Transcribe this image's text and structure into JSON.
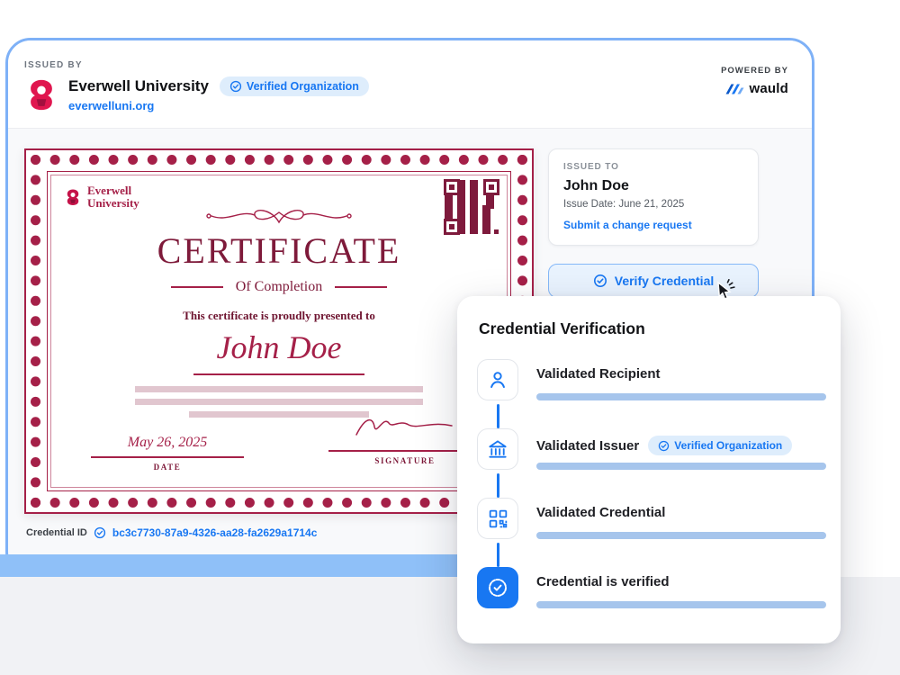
{
  "header": {
    "issued_by_label": "ISSUED BY",
    "org_name": "Everwell University",
    "org_url": "everwelluni.org",
    "verified_badge_label": "Verified Organization",
    "powered_by_label": "POWERED BY",
    "brand_name": "wauld"
  },
  "certificate": {
    "org_line1": "Everwell",
    "org_line2": "University",
    "title": "CERTIFICATE",
    "subtitle": "Of Completion",
    "presented_text": "This certificate is proudly presented to",
    "recipient_name": "John Doe",
    "date_value": "May 26, 2025",
    "date_label": "DATE",
    "signature_label": "SIGNATURE"
  },
  "credential_id": {
    "label": "Credential ID",
    "value": "bc3c7730-87a9-4326-aa28-fa2629a1714c"
  },
  "issued_to": {
    "label": "ISSUED TO",
    "name": "John Doe",
    "issue_date": "Issue Date: June 21, 2025",
    "change_request_label": "Submit a change request"
  },
  "verify_button": {
    "label": "Verify Credential"
  },
  "modal": {
    "title": "Credential Verification",
    "steps": [
      {
        "label": "Validated Recipient",
        "icon": "user-icon",
        "progress_percent": 100
      },
      {
        "label": "Validated Issuer",
        "icon": "bank-icon",
        "badge": "Verified Organization",
        "progress_percent": 100
      },
      {
        "label": "Validated Credential",
        "icon": "qr-icon",
        "progress_percent": 100
      },
      {
        "label": "Credential is verified",
        "icon": "seal-check-icon",
        "progress_percent": 100
      }
    ]
  },
  "colors": {
    "accent_blue": "#1877F2",
    "border_blue": "#7EB1F7",
    "badge_bg": "#DEEDFC",
    "progress": "#A6C5EC",
    "cert_red": "#A52048",
    "bar_blue": "#8FC0F8"
  }
}
